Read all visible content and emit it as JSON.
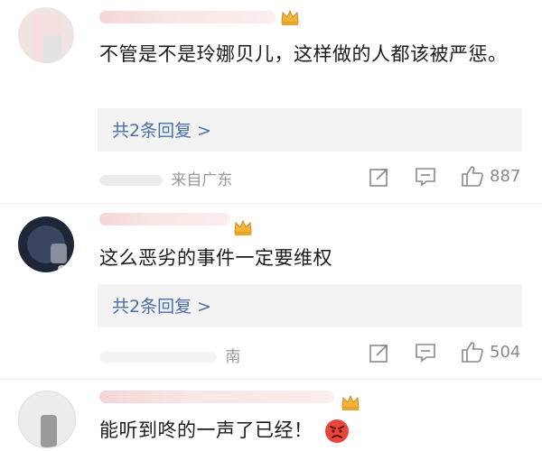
{
  "comments": [
    {
      "text": "不管是不是玲娜贝儿，这样做的人都该被严惩。",
      "replies_label": "共2条回复 >",
      "location": "来自广东",
      "likes": "887"
    },
    {
      "text": "这么恶劣的事件一定要维权",
      "replies_label": "共2条回复 >",
      "location": "南",
      "likes": "504"
    },
    {
      "text": "能听到咚的一声了已经！"
    }
  ],
  "icons": {
    "share": "share-icon",
    "comment": "comment-icon",
    "like": "thumbs-up-icon",
    "badge": "vip-crown-icon",
    "emoji": "angry-face-icon"
  },
  "colors": {
    "link": "#4a6ea8",
    "meta": "#999999",
    "reply_bg": "#f3f3f3",
    "crown": "#f0b43a"
  }
}
